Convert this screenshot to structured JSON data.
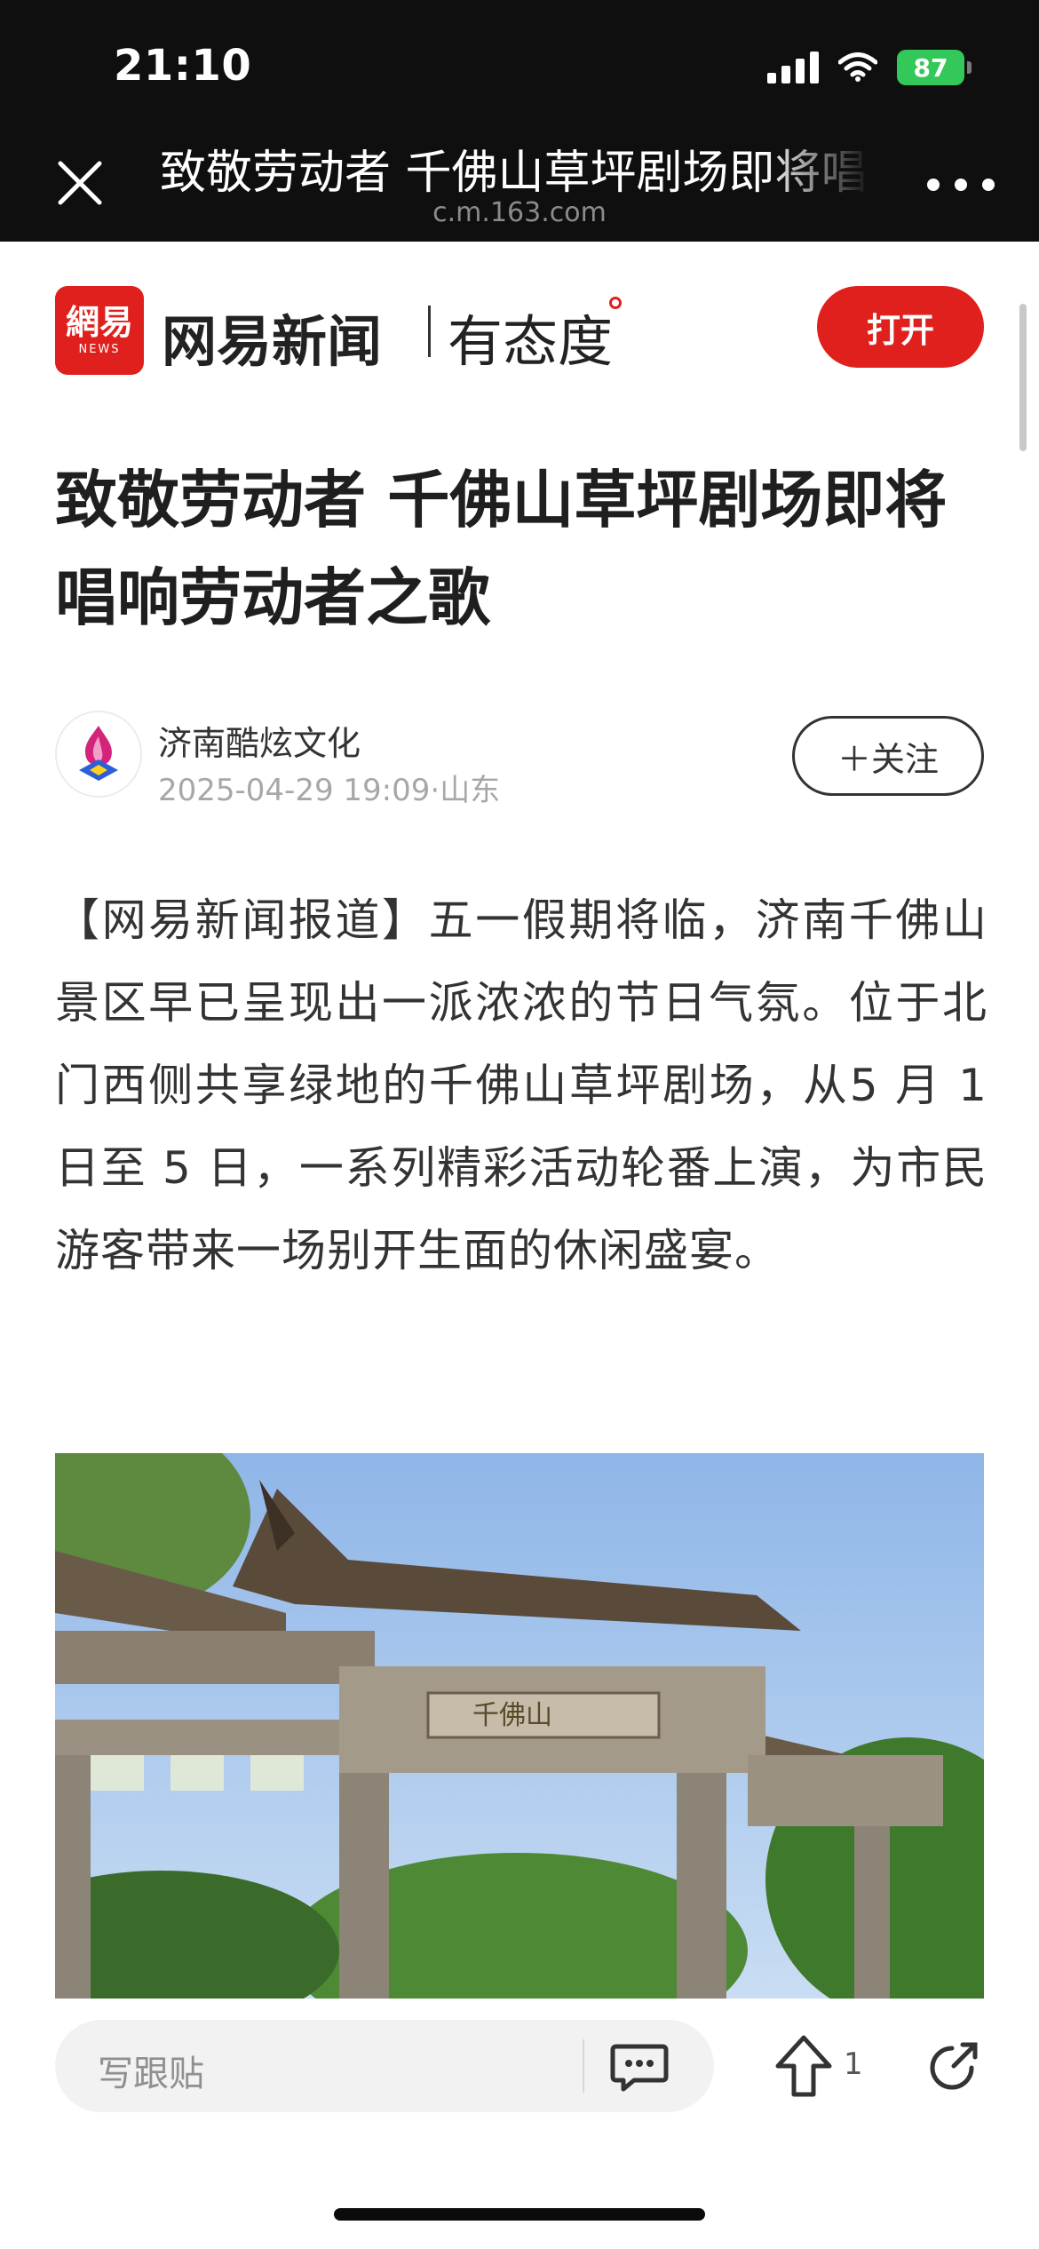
{
  "status_bar": {
    "time": "21:10",
    "battery": "87"
  },
  "nav": {
    "title": "致敬劳动者 千佛山草坪剧场即将唱响劳动者之歌",
    "url": "c.m.163.com"
  },
  "brand": {
    "logo_text": "網易",
    "logo_sub": "NEWS",
    "name": "网易新闻",
    "slogan": "有态度",
    "open_label": "打开",
    "accent_color": "#e0201c"
  },
  "article": {
    "title": "致敬劳动者 千佛山草坪剧场即将唱响劳动者之歌",
    "author": "济南酷炫文化",
    "meta": "2025-04-29 19:09·山东",
    "follow_label": "＋关注",
    "body": "【网易新闻报道】五一假期将临，济南千佛山景区早已呈现出一派浓浓的节日气氛。位于北门西侧共享绿地的千佛山草坪剧场，从5 月 1 日至 5 日，一系列精彩活动轮番上演，为市民游客带来一场别开生面的休闲盛宴。",
    "image_caption_text": "千佛山"
  },
  "bottom_bar": {
    "comment_placeholder": "写跟贴",
    "up_count": "1"
  }
}
